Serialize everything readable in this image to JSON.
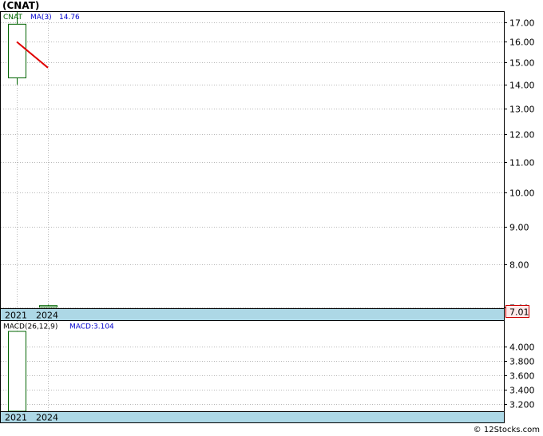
{
  "header": {
    "title": "(CNAT)"
  },
  "footer": {
    "credit": "© 12Stocks.com"
  },
  "colors": {
    "grid": "#b8b8b8",
    "frame": "#000000",
    "x_band": "#add8e6",
    "candle": "#006400",
    "ma_line": "#e00000",
    "macd_legend": "#0000cc",
    "last_price_box_border": "#cc0000",
    "last_price_box_fill": "#fde8e8"
  },
  "chart_data": [
    {
      "type": "candlestick",
      "y_ticks": [
        7.0,
        8.0,
        9.0,
        10.0,
        11.0,
        12.0,
        13.0,
        14.0,
        15.0,
        16.0,
        17.0
      ],
      "y_tick_labels": [
        "7.00",
        "8.00",
        "9.00",
        "10.00",
        "11.00",
        "12.00",
        "13.00",
        "14.00",
        "15.00",
        "16.00",
        "17.00"
      ],
      "ylim": [
        7.0,
        17.6
      ],
      "log_scale": true,
      "grid": true,
      "x_labels": [
        "2021",
        "2024"
      ],
      "legend": {
        "ticker": "CNAT",
        "ma_label": "MA(3)",
        "ma_value": "14.76"
      },
      "last_price_label": "7.01",
      "candles": [
        {
          "period": "2021",
          "open": 14.3,
          "close": 16.9,
          "high": 17.6,
          "low": 14.0
        },
        {
          "period": "2024",
          "open": 7.04,
          "close": 7.01,
          "high": 7.06,
          "low": 7.0
        }
      ],
      "ma_line": [
        {
          "period": "2021",
          "value": 16.0
        },
        {
          "period": "2024",
          "value": 14.76
        }
      ]
    },
    {
      "type": "bar",
      "legend": {
        "label": "MACD(26,12,9)",
        "value_label": "MACD:3.104"
      },
      "y_ticks": [
        3.2,
        3.4,
        3.6,
        3.8,
        4.0
      ],
      "y_tick_labels": [
        "3.200",
        "3.400",
        "3.600",
        "3.800",
        "4.000"
      ],
      "ylim": [
        3.104,
        4.21
      ],
      "grid": true,
      "x_labels": [
        "2021",
        "2024"
      ],
      "bars": [
        {
          "period": "2021",
          "value": 4.21
        }
      ]
    }
  ]
}
